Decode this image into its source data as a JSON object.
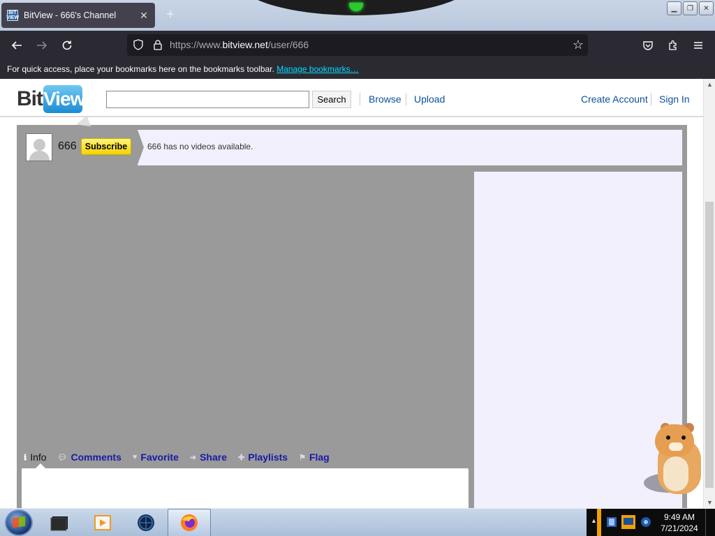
{
  "browser": {
    "tab_title": "BitView - 666's Channel",
    "favicon_text": "BIT VIEW",
    "url_prefix": "https://www.",
    "url_domain": "bitview.net",
    "url_path": "/user/666",
    "bookmarks_message": "For quick access, place your bookmarks here on the bookmarks toolbar.",
    "bookmarks_link": "Manage bookmarks…",
    "dark_chrome_color": "#2b2a33",
    "link_accent_color": "#00ddff"
  },
  "site": {
    "logo_bit": "Bit",
    "logo_view": "View",
    "search_value": "",
    "search_button": "Search",
    "nav": {
      "browse": "Browse",
      "upload": "Upload",
      "create_account": "Create Account",
      "sign_in": "Sign In"
    },
    "link_color": "#0b4f9c"
  },
  "channel": {
    "name": "666",
    "subscribe_label": "Subscribe",
    "no_videos_text": "666 has no videos available.",
    "tabs": [
      {
        "label": "Info",
        "icon": "info-icon",
        "active": true
      },
      {
        "label": "Comments",
        "icon": "comment-icon",
        "active": false
      },
      {
        "label": "Favorite",
        "icon": "heart-icon",
        "active": false
      },
      {
        "label": "Share",
        "icon": "share-arrow-icon",
        "active": false
      },
      {
        "label": "Playlists",
        "icon": "plus-icon",
        "active": false
      },
      {
        "label": "Flag",
        "icon": "flag-icon",
        "active": false
      }
    ],
    "background_color": "#9a9a9a",
    "panel_color": "#f1f0fc",
    "subscribe_color": "#f6d400"
  },
  "taskbar": {
    "apps": [
      {
        "name": "media-center-icon",
        "active": false
      },
      {
        "name": "media-player-icon",
        "active": false
      },
      {
        "name": "globe-icon",
        "active": false
      },
      {
        "name": "firefox-icon",
        "active": true
      }
    ],
    "time": "9:49 AM",
    "date": "7/21/2024"
  }
}
